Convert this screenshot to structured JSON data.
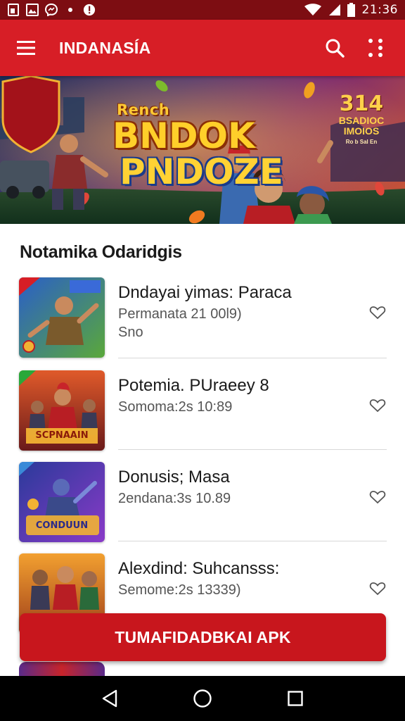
{
  "status_bar": {
    "time": "21:36",
    "icons_left": [
      "sim-card-icon",
      "image-icon",
      "messenger-icon",
      "dot-icon",
      "alert-circle-icon"
    ],
    "icons_right": [
      "wifi-icon",
      "signal-icon",
      "battery-icon"
    ]
  },
  "app_bar": {
    "title": "INDANASÍA",
    "accent_color": "#d71e26",
    "icons": [
      "menu-icon",
      "search-icon",
      "more-vert-icon"
    ]
  },
  "banner": {
    "small_text": "Rench",
    "line1": "BNDOK",
    "line2": "PNDOZE",
    "badge": {
      "number": "314",
      "line1": "BSADIOC",
      "line2": "IMOIOS",
      "line3": "Ro b  Sal  En"
    }
  },
  "section": {
    "title": "Notamika Odaridgis"
  },
  "list": [
    {
      "title": "Dndayai yimas: Paraca",
      "meta": "Permanata 21 00l9)",
      "meta2": "Sno",
      "thumb_caption": ""
    },
    {
      "title": "Potemia. PUraeey 8",
      "meta": "Somoma:2s 10:89",
      "meta2": "",
      "thumb_caption": "SCPNAAIN"
    },
    {
      "title": "Donusis; Masa",
      "meta": "2endana:3s 10.89",
      "meta2": "",
      "thumb_caption": "CONDUUN"
    },
    {
      "title": "Alexdind: Suhcansss:",
      "meta": "Semome:2s 13339)",
      "meta2": "",
      "thumb_caption": ""
    }
  ],
  "cta": {
    "label": "TUMAFIDADBKAI APK"
  },
  "nav_bar": {
    "icons": [
      "back-icon",
      "home-icon",
      "recents-icon"
    ]
  },
  "colors": {
    "primary": "#d71e26",
    "status_bar": "#7d0d12",
    "cta": "#c8161d"
  }
}
